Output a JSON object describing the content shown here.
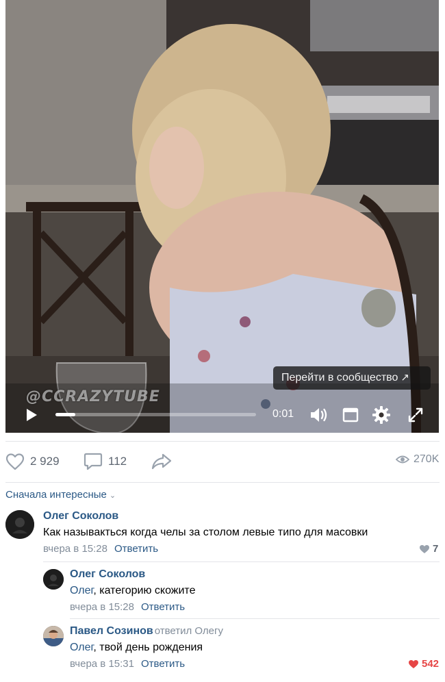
{
  "video": {
    "watermark": "@CCRAZYTUBE",
    "community_button": "Перейти в сообщество",
    "time": "0:01",
    "progress": 0.1
  },
  "actions": {
    "likes": "2 929",
    "comments": "112",
    "views": "270K"
  },
  "sort": {
    "label": "Сначала интересные"
  },
  "comments": [
    {
      "author": "Олег Соколов",
      "text": "Как называкться когда челы за столом левые типо для масовки",
      "time": "вчера в 15:28",
      "reply": "Ответить",
      "likes": "7"
    },
    {
      "author": "Олег Соколов",
      "mention": "Олег",
      "text": ", категорию скожите",
      "time": "вчера в 15:28",
      "reply": "Ответить"
    },
    {
      "author": "Павел Созинов",
      "replied_to": "ответил Олегу",
      "mention": "Олег",
      "text": ", твой день рождения",
      "time": "вчера в 15:31",
      "reply": "Ответить",
      "likes": "542"
    }
  ],
  "colors": {
    "link": "#2a5885",
    "muted": "#818c99",
    "liked": "#e64646",
    "divider": "#e3e4e8"
  }
}
